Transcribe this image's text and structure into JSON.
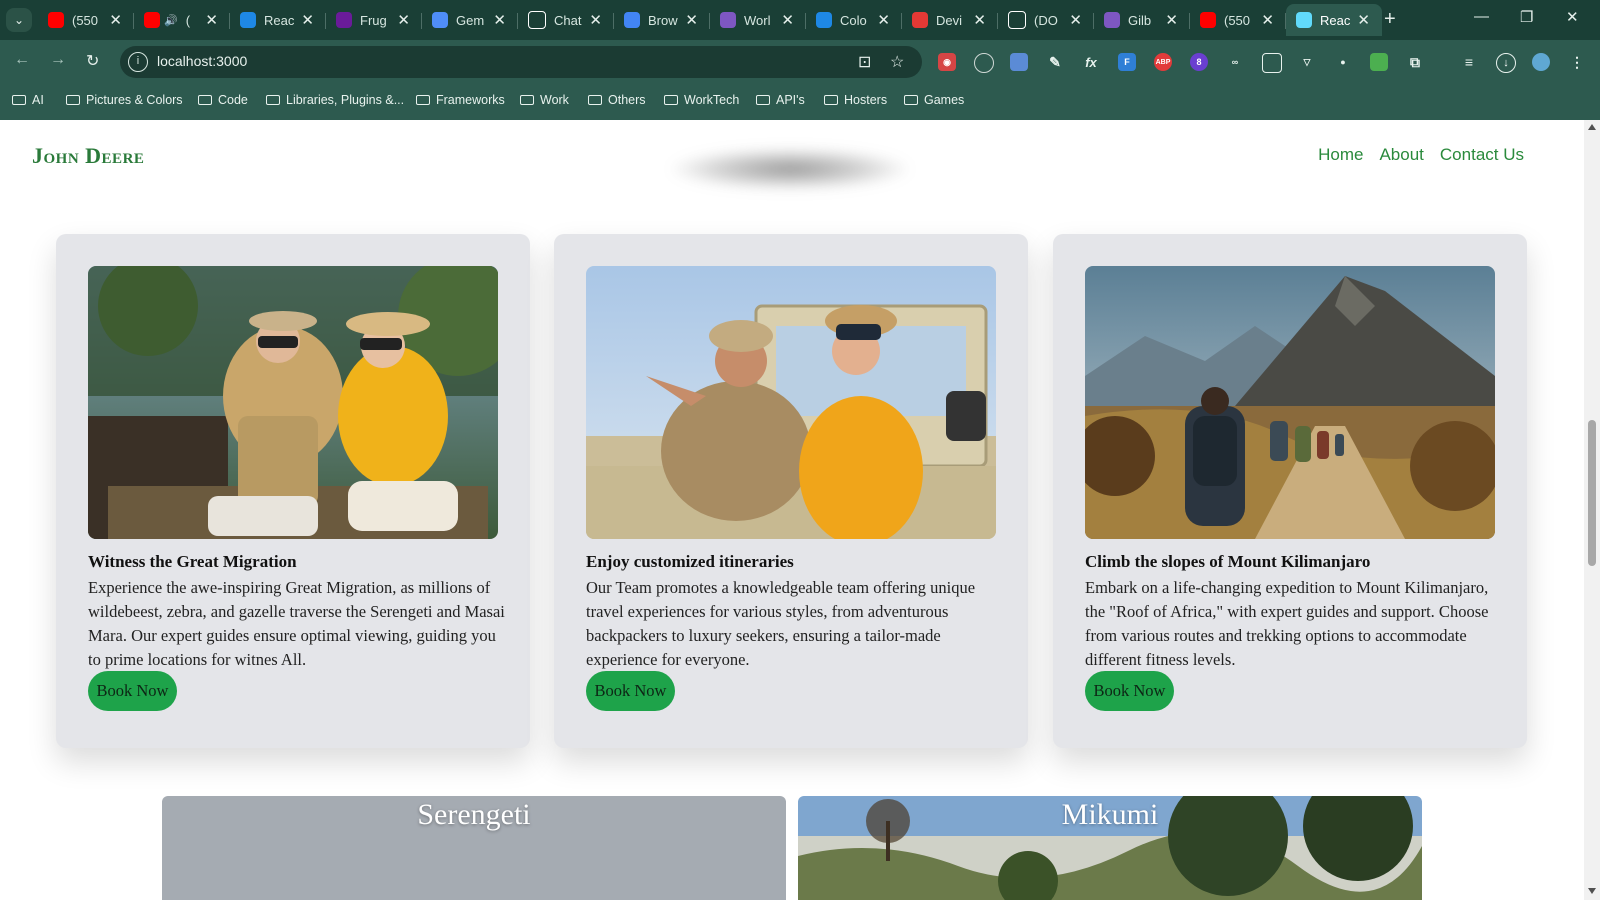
{
  "browser": {
    "tabs": [
      {
        "label": "(550",
        "favicon": "youtube-icon",
        "color": "#ff0000"
      },
      {
        "label": "(",
        "favicon": "youtube-icon",
        "color": "#ff0000",
        "audio": true
      },
      {
        "label": "Reac",
        "favicon": "mui-icon",
        "color": "#1e88e5"
      },
      {
        "label": "Frug",
        "favicon": "frugal-icon",
        "color": "#6a1b9a"
      },
      {
        "label": "Gem",
        "favicon": "gemini-icon",
        "color": "#4f8df7"
      },
      {
        "label": "Chat",
        "favicon": "chatgpt-icon",
        "color": "#ffffff"
      },
      {
        "label": "Brow",
        "favicon": "browserstack-icon",
        "color": "#4285f4"
      },
      {
        "label": "Worl",
        "favicon": "rocket-icon",
        "color": "#7e57c2"
      },
      {
        "label": "Colo",
        "favicon": "color-icon",
        "color": "#1e88e5"
      },
      {
        "label": "Devi",
        "favicon": "x-icon",
        "color": "#e53935"
      },
      {
        "label": "(DO",
        "favicon": "a-icon",
        "color": "#ffffff"
      },
      {
        "label": "Gilb",
        "favicon": "rocket-icon",
        "color": "#7e57c2"
      },
      {
        "label": "(550",
        "favicon": "youtube-icon",
        "color": "#ff0000"
      },
      {
        "label": "Reac",
        "favicon": "react-icon",
        "color": "#61dafb",
        "active": true
      }
    ],
    "url": "localhost:3000",
    "bookmarks": [
      "AI",
      "Pictures & Colors",
      "Code",
      "Libraries, Plugins &...",
      "Frameworks",
      "Work",
      "Others",
      "WorkTech",
      "API's",
      "Hosters",
      "Games"
    ],
    "ext_badge": "8"
  },
  "site": {
    "logo": "John Deere",
    "nav": [
      "Home",
      "About",
      "Contact Us"
    ]
  },
  "cards": [
    {
      "title": "Witness the Great Migration",
      "text": "Experience the awe-inspiring Great Migration, as millions of wildebeest, zebra, and gazelle traverse the Serengeti and Masai Mara. Our expert guides ensure optimal viewing, guiding you to prime locations for witnes All.",
      "button": "Book Now"
    },
    {
      "title": "Enjoy customized itineraries",
      "text": "Our Team promotes a knowledgeable team offering unique travel experiences for various styles, from adventurous backpackers to luxury seekers, ensuring a tailor-made experience for everyone.",
      "button": "Book Now"
    },
    {
      "title": "Climb the slopes of Mount Kilimanjaro",
      "text": "Embark on a life-changing expedition to Mount Kilimanjaro, the \"Roof of Africa,\" with expert guides and support. Choose from various routes and trekking options to accommodate different fitness levels.",
      "button": "Book Now"
    }
  ],
  "destinations": [
    "Serengeti",
    "Mikumi"
  ],
  "colors": {
    "chrome_dark": "#1a3f36",
    "chrome": "#2d5a4f",
    "brand_green": "#2a8a3c",
    "button_green": "#1ea34a",
    "card_bg": "#e4e5e9"
  }
}
